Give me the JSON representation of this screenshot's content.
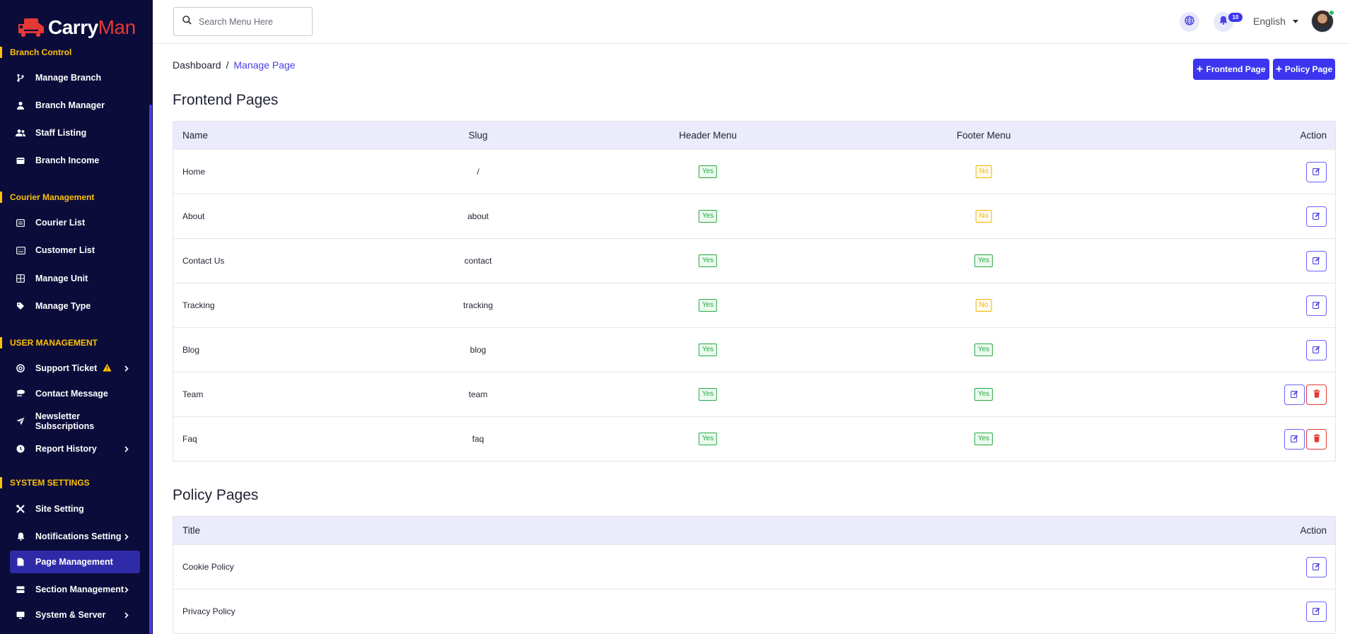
{
  "app": {
    "brand_carry": "Carry",
    "brand_man": "Man"
  },
  "search": {
    "placeholder": "Search Menu Here"
  },
  "header": {
    "notif_count": "10",
    "language": "English"
  },
  "sidebar": {
    "sections": [
      {
        "label": "Branch Control"
      },
      {
        "label": "Courier Management"
      },
      {
        "label": "USER MANAGEMENT"
      },
      {
        "label": "SYSTEM SETTINGS"
      }
    ],
    "items": [
      {
        "label": "Manage Branch"
      },
      {
        "label": "Branch Manager"
      },
      {
        "label": "Staff Listing"
      },
      {
        "label": "Branch Income"
      },
      {
        "label": "Courier List"
      },
      {
        "label": "Customer List"
      },
      {
        "label": "Manage Unit"
      },
      {
        "label": "Manage Type"
      },
      {
        "label": "Support Ticket"
      },
      {
        "label": "Contact Message"
      },
      {
        "label": "Newsletter Subscriptions"
      },
      {
        "label": "Report History"
      },
      {
        "label": "Site Setting"
      },
      {
        "label": "Notifications Setting"
      },
      {
        "label": "Page Management"
      },
      {
        "label": "Section Management"
      },
      {
        "label": "System & Server"
      }
    ]
  },
  "breadcrumb": {
    "root": "Dashboard",
    "sep": "/",
    "current": "Manage Page"
  },
  "actions": {
    "frontend_btn": "Frontend Page",
    "policy_btn": "Policy Page"
  },
  "frontend": {
    "title": "Frontend Pages",
    "columns": {
      "name": "Name",
      "slug": "Slug",
      "header": "Header Menu",
      "footer": "Footer Menu",
      "action": "Action"
    },
    "rows": [
      {
        "name": "Home",
        "slug": "/",
        "header": "Yes",
        "footer": "No"
      },
      {
        "name": "About",
        "slug": "about",
        "header": "Yes",
        "footer": "No"
      },
      {
        "name": "Contact Us",
        "slug": "contact",
        "header": "Yes",
        "footer": "Yes"
      },
      {
        "name": "Tracking",
        "slug": "tracking",
        "header": "Yes",
        "footer": "No"
      },
      {
        "name": "Blog",
        "slug": "blog",
        "header": "Yes",
        "footer": "Yes"
      },
      {
        "name": "Team",
        "slug": "team",
        "header": "Yes",
        "footer": "Yes"
      },
      {
        "name": "Faq",
        "slug": "faq",
        "header": "Yes",
        "footer": "Yes"
      }
    ]
  },
  "policy": {
    "title": "Policy Pages",
    "columns": {
      "title": "Title",
      "action": "Action"
    },
    "rows": [
      {
        "title": "Cookie Policy"
      },
      {
        "title": "Privacy Policy"
      }
    ]
  },
  "colors": {
    "sidebar_bg": "#0b0c3a",
    "accent": "#3b35f0",
    "section_label": "#ffc107",
    "yes": "#28a745",
    "no": "#f5b400",
    "delete": "#e53935"
  }
}
